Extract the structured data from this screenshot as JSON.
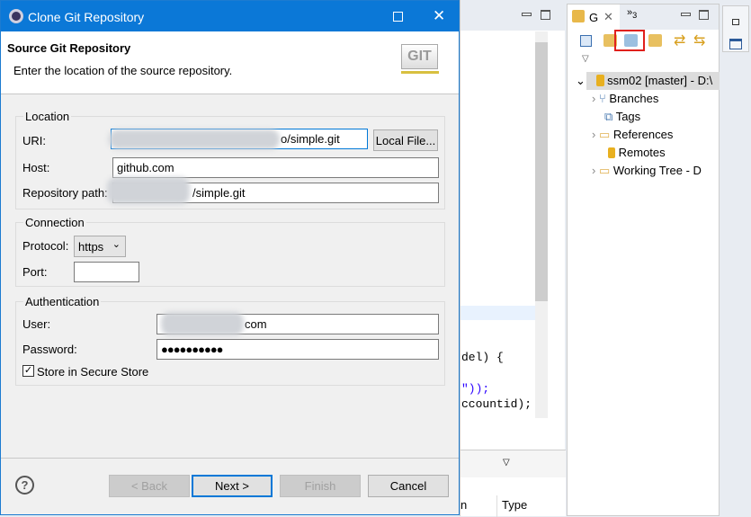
{
  "dialog": {
    "title": "Clone Git Repository",
    "header_title": "Source Git Repository",
    "header_desc": "Enter the location of the source repository.",
    "logo_text": "GIT",
    "location": {
      "group_label": "Location",
      "uri_label": "URI:",
      "uri_value": "o/simple.git",
      "local_file_button": "Local File...",
      "host_label": "Host:",
      "host_value": "github.com",
      "repo_path_label": "Repository path:",
      "repo_path_value": "/simple.git"
    },
    "connection": {
      "group_label": "Connection",
      "protocol_label": "Protocol:",
      "protocol_value": "https",
      "port_label": "Port:",
      "port_value": ""
    },
    "authentication": {
      "group_label": "Authentication",
      "user_label": "User:",
      "user_value": "com",
      "password_label": "Password:",
      "password_value": "●●●●●●●●●●",
      "store_label": "Store in Secure Store",
      "store_checked": true
    },
    "buttons": {
      "back": "< Back",
      "next": "Next >",
      "finish": "Finish",
      "cancel": "Cancel"
    }
  },
  "editor": {
    "code_lines": [
      "del) {",
      "\"));",
      "ccountid);"
    ]
  },
  "bottom_panel": {
    "column_type": "Type",
    "column_prev": "n"
  },
  "git_view": {
    "tab_label": "G",
    "overflow_count": "3",
    "tree": [
      {
        "label": "ssm02 [master] - D:\\",
        "icon": "repository-icon",
        "expanded": true
      },
      {
        "label": "Branches",
        "icon": "branches-icon",
        "expandable": true
      },
      {
        "label": "Tags",
        "icon": "tags-icon",
        "expandable": false
      },
      {
        "label": "References",
        "icon": "folder-icon",
        "expandable": true
      },
      {
        "label": "Remotes",
        "icon": "remotes-icon",
        "expandable": false
      },
      {
        "label": "Working Tree - D",
        "icon": "folder-icon",
        "expandable": true
      }
    ],
    "highlight_color": "#e0201c"
  },
  "colors": {
    "titlebar": "#0b78d7",
    "default_button_border": "#0078d7"
  }
}
